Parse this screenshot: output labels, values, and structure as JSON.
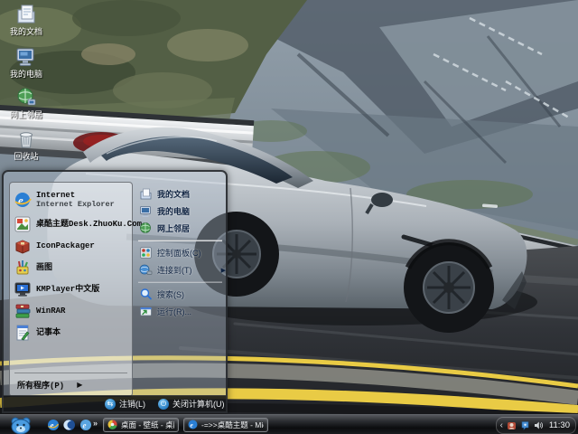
{
  "desktop": {
    "icons": [
      {
        "label": "我的文档"
      },
      {
        "label": "我的电脑"
      },
      {
        "label": "网上邻居"
      },
      {
        "label": "回收站"
      }
    ]
  },
  "start_menu": {
    "left_items": [
      {
        "label": "Internet",
        "sublabel": "Internet Explorer"
      },
      {
        "label": "桌酷主题Desk.ZhuoKu.Com"
      },
      {
        "label": "IconPackager"
      },
      {
        "label": "画图"
      },
      {
        "label": "KMPlayer中文版"
      },
      {
        "label": "WinRAR"
      },
      {
        "label": "记事本"
      }
    ],
    "all_programs": "所有程序(P)",
    "all_programs_arrow": "▶",
    "right_items": [
      {
        "label": "我的文档"
      },
      {
        "label": "我的电脑"
      },
      {
        "label": "网上邻居"
      },
      {
        "label": "控制面板(C)"
      },
      {
        "label": "连接到(T)"
      },
      {
        "label": "搜索(S)"
      },
      {
        "label": "运行(R)..."
      }
    ],
    "connect_arrow": "▶",
    "log_off": "注销(L)",
    "shut_down": "关闭计算机(U)"
  },
  "taskbar": {
    "quick_launch_chevron": "»",
    "buttons": [
      {
        "label": "桌面 - 壁纸 - 桌酷壁..."
      },
      {
        "label": "-=>>桌酷主题 - Mic..."
      }
    ],
    "tray_collapse": "‹",
    "clock": "11:30"
  },
  "colors": {
    "road_yellow": "#e9cb45",
    "taskbar_black": "#0b0c0e",
    "menu_translucent_white": "rgba(248,250,252,0.48)"
  }
}
